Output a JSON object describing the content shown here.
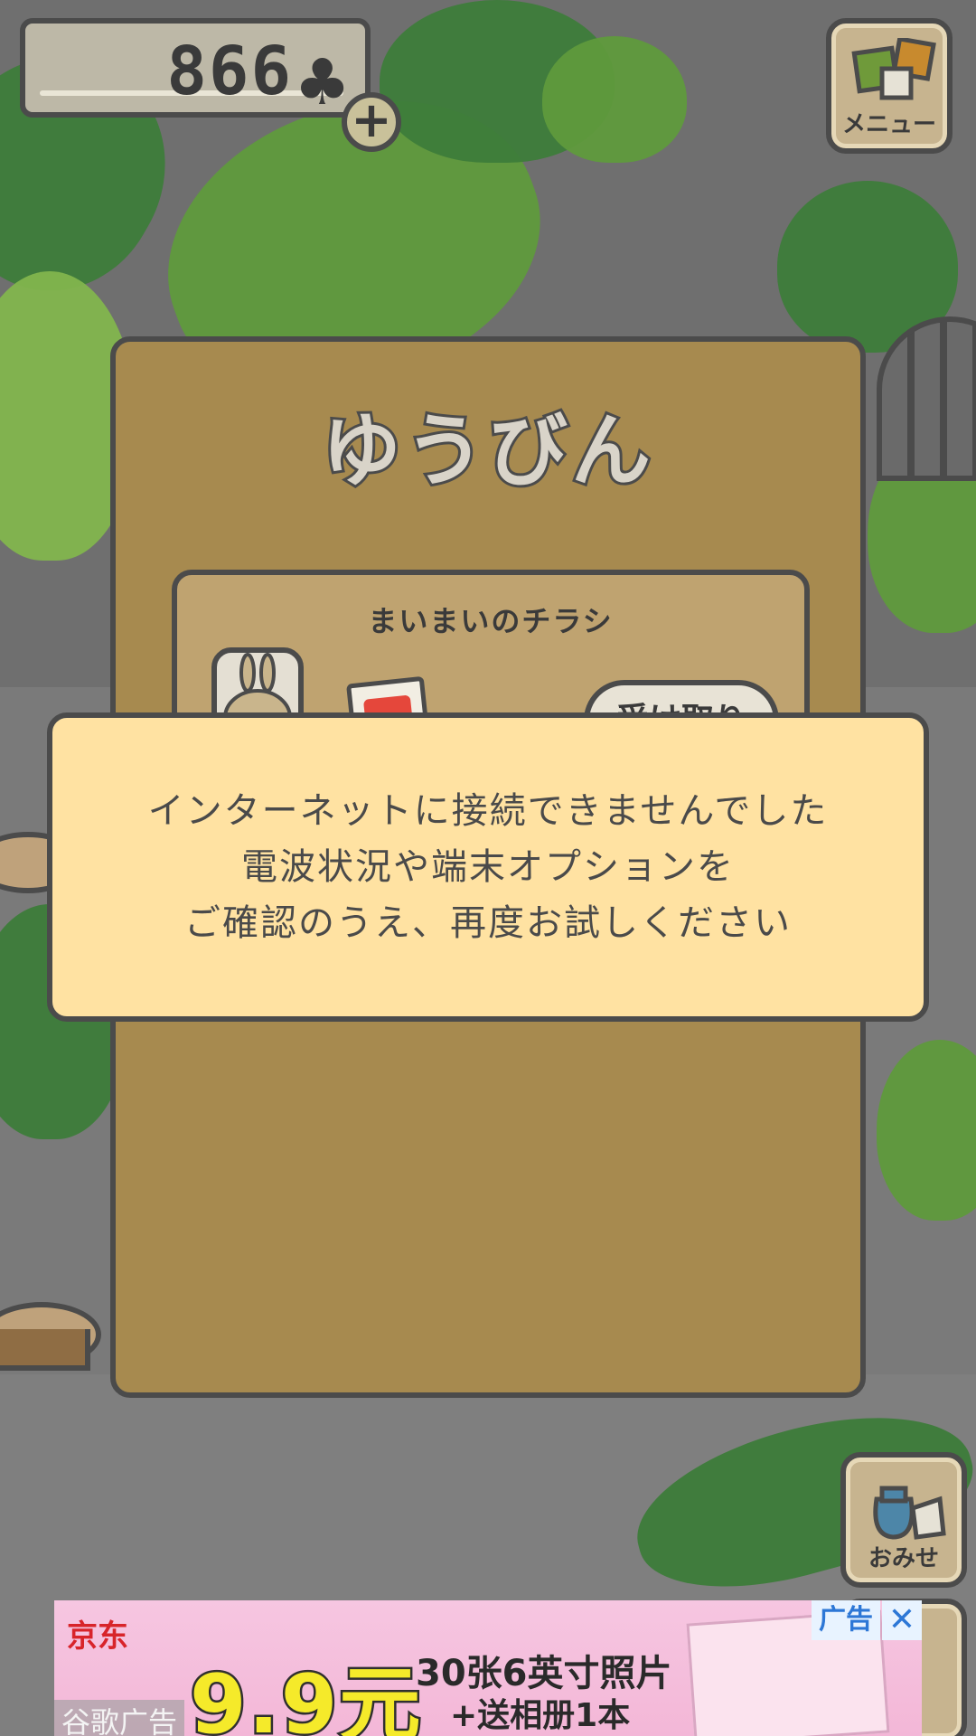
{
  "header": {
    "clover_count": "866",
    "clover_icon": "♣",
    "add_button_label": "+"
  },
  "side_buttons": {
    "menu_label": "メニュー",
    "shop_label": "おみせ"
  },
  "mail_panel": {
    "title": "ゆうびん",
    "item": {
      "title": "まいまいのチラシ",
      "receive_label": "受け取り"
    }
  },
  "error_dialog": {
    "lines": [
      "インターネットに接続できませんでした",
      "電波状況や端末オプションを",
      "ご確認のうえ、再度お試しください"
    ]
  },
  "ad_banner": {
    "brand": "京东",
    "price": "9.9元",
    "line1": "30张6英寸照片",
    "line2": "+送相册1本",
    "ad_label": "广告",
    "close_icon": "✕",
    "source_label": "谷歌广告"
  },
  "colors": {
    "panel": "#a78a4f",
    "dialog": "#ffe2a2",
    "outline": "#4b4b4b"
  }
}
